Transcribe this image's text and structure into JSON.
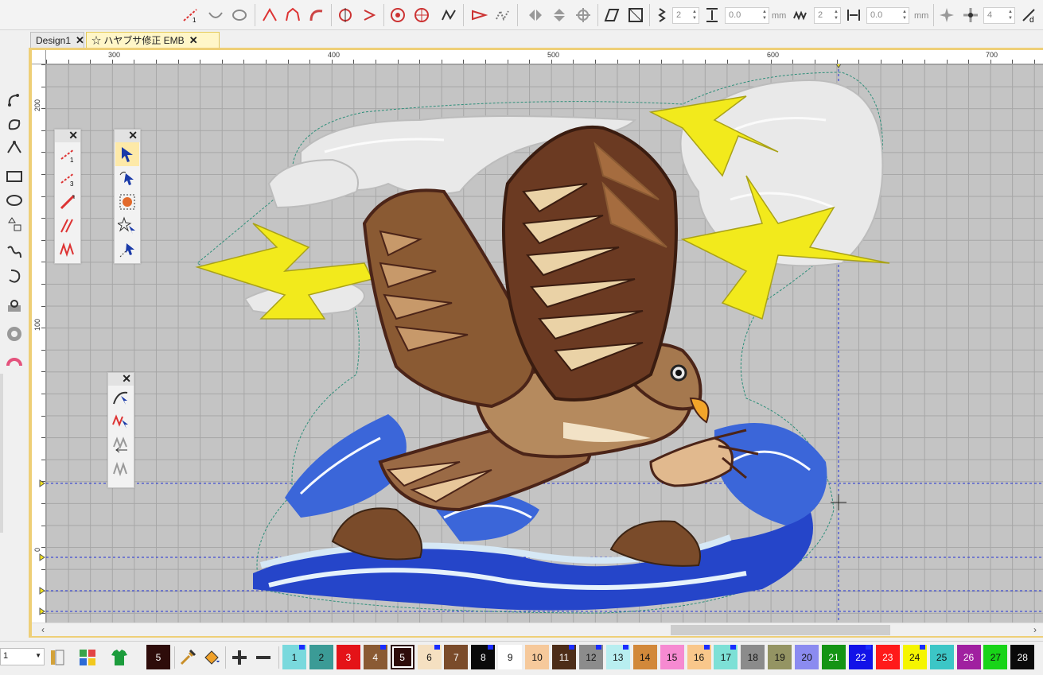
{
  "window": {
    "title": ""
  },
  "tabs": [
    {
      "label": "Design1",
      "close": "✕"
    },
    {
      "label": "☆ ハヤブサ修正 EMB",
      "close": "✕"
    }
  ],
  "toolbar": {
    "stitch_count_value": "2",
    "spacing_value": "0.0",
    "spacing_unit": "mm",
    "repeat_value": "2",
    "offset_value": "0.0",
    "offset_unit": "mm",
    "points_value": "4"
  },
  "rulers": {
    "top_labels": [
      "300",
      "400",
      "500",
      "600",
      "700"
    ],
    "left_labels": [
      "200",
      "100",
      "0"
    ]
  },
  "palettes": {
    "close_symbol": "✕",
    "line_palette_labels": [
      "1",
      "3"
    ]
  },
  "bottom": {
    "zoom_value": "1",
    "current_color_number": "5",
    "colors": [
      {
        "number": "1",
        "color": "#79d9dd",
        "text_color": "#111111",
        "flag": true
      },
      {
        "number": "2",
        "color": "#3b9b96",
        "text_color": "#111111",
        "flag": false
      },
      {
        "number": "3",
        "color": "#e41318",
        "text_color": "#ffffff",
        "flag": false
      },
      {
        "number": "4",
        "color": "#8a5a33",
        "text_color": "#ffffff",
        "flag": true
      },
      {
        "number": "5",
        "color": "#2e0c0a",
        "text_color": "#ffffff",
        "flag": false,
        "selected": true
      },
      {
        "number": "6",
        "color": "#f5e0c1",
        "text_color": "#111111",
        "flag": true
      },
      {
        "number": "7",
        "color": "#7a4b2a",
        "text_color": "#ffffff",
        "flag": false
      },
      {
        "number": "8",
        "color": "#0a0a0a",
        "text_color": "#ffffff",
        "flag": true
      },
      {
        "number": "9",
        "color": "#ffffff",
        "text_color": "#111111",
        "flag": false
      },
      {
        "number": "10",
        "color": "#f6c99b",
        "text_color": "#111111",
        "flag": false
      },
      {
        "number": "11",
        "color": "#4d2d18",
        "text_color": "#ffffff",
        "flag": true
      },
      {
        "number": "12",
        "color": "#8c8c8c",
        "text_color": "#111111",
        "flag": true
      },
      {
        "number": "13",
        "color": "#b8eef0",
        "text_color": "#111111",
        "flag": true
      },
      {
        "number": "14",
        "color": "#d2883a",
        "text_color": "#111111",
        "flag": false
      },
      {
        "number": "15",
        "color": "#f68ad1",
        "text_color": "#111111",
        "flag": false
      },
      {
        "number": "16",
        "color": "#f9c78b",
        "text_color": "#111111",
        "flag": true
      },
      {
        "number": "17",
        "color": "#7de0d6",
        "text_color": "#111111",
        "flag": true
      },
      {
        "number": "18",
        "color": "#8b8b8b",
        "text_color": "#111111",
        "flag": false
      },
      {
        "number": "19",
        "color": "#949463",
        "text_color": "#111111",
        "flag": false
      },
      {
        "number": "20",
        "color": "#8b8bf0",
        "text_color": "#111111",
        "flag": false
      },
      {
        "number": "21",
        "color": "#149414",
        "text_color": "#ffffff",
        "flag": false
      },
      {
        "number": "22",
        "color": "#1212e8",
        "text_color": "#ffffff",
        "flag": true
      },
      {
        "number": "23",
        "color": "#ff1a1a",
        "text_color": "#ffffff",
        "flag": false
      },
      {
        "number": "24",
        "color": "#f5f500",
        "text_color": "#111111",
        "flag": true
      },
      {
        "number": "25",
        "color": "#3cc6c6",
        "text_color": "#111111",
        "flag": false
      },
      {
        "number": "26",
        "color": "#a020a0",
        "text_color": "#ffffff",
        "flag": false
      },
      {
        "number": "27",
        "color": "#18d418",
        "text_color": "#111111",
        "flag": false
      },
      {
        "number": "28",
        "color": "#0a0a0a",
        "text_color": "#ffffff",
        "flag": false
      }
    ]
  },
  "design": {
    "description_colors": {
      "wing_dark": "#4b2418",
      "wing_mid": "#9a6a45",
      "wing_light": "#e8c79a",
      "cloud": "#ececec",
      "lightning": "#f2ea1c",
      "water_blue": "#2545c9",
      "water_light": "#d6e8f5"
    }
  }
}
